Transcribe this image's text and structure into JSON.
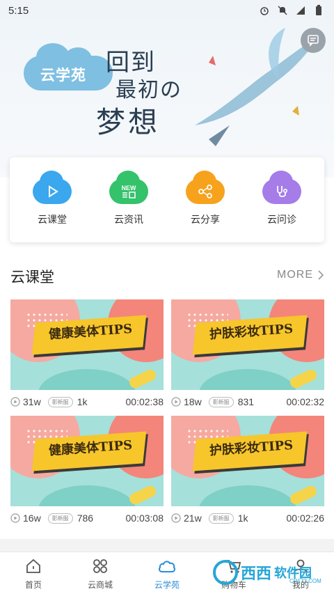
{
  "status_bar": {
    "time": "5:15",
    "network": "4G"
  },
  "banner": {
    "brand": "云学苑",
    "line1": "回到",
    "line2": "最初の",
    "line3": "梦想"
  },
  "quick_entries": [
    {
      "label": "云课堂",
      "icon": "play-cloud-icon",
      "color": "#3aa7ee"
    },
    {
      "label": "云资讯",
      "icon": "news-cloud-icon",
      "color": "#34c26b",
      "badge": "NEW"
    },
    {
      "label": "云分享",
      "icon": "share-cloud-icon",
      "color": "#f7a21c"
    },
    {
      "label": "云问诊",
      "icon": "stethoscope-cloud-icon",
      "color": "#a57ce8"
    }
  ],
  "section": {
    "title": "云课堂",
    "more": "MORE"
  },
  "courses": [
    {
      "title": "健康美体TIPS",
      "views": "31w",
      "tag": "影新服",
      "likes": "1k",
      "duration": "00:02:38"
    },
    {
      "title": "护肤彩妆TIPS",
      "views": "18w",
      "tag": "影新服",
      "likes": "831",
      "duration": "00:02:32"
    },
    {
      "title": "健康美体TIPS",
      "views": "16w",
      "tag": "影新服",
      "likes": "786",
      "duration": "00:03:08"
    },
    {
      "title": "护肤彩妆TIPS",
      "views": "21w",
      "tag": "影新服",
      "likes": "1k",
      "duration": "00:02:26"
    }
  ],
  "bottom_nav": [
    {
      "label": "首页",
      "icon": "home-icon"
    },
    {
      "label": "云商城",
      "icon": "grid-icon"
    },
    {
      "label": "云学苑",
      "icon": "cloud-icon",
      "active": true
    },
    {
      "label": "购物车",
      "icon": "cart-icon"
    },
    {
      "label": "我的",
      "icon": "user-icon"
    }
  ],
  "watermark": {
    "text": "西西",
    "text2": "软件园",
    "sub": "CR173.COM"
  },
  "colors": {
    "accent": "#2a8cd8",
    "ribbon": "#f7c62b"
  }
}
